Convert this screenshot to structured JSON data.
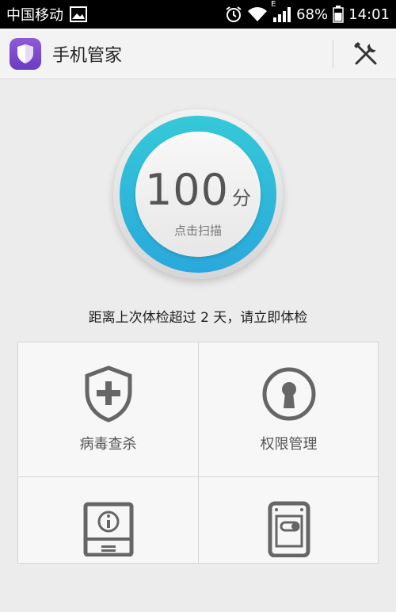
{
  "status_bar": {
    "carrier": "中国移动",
    "network": "E",
    "battery": "68%",
    "time": "14:01"
  },
  "app": {
    "title": "手机管家"
  },
  "score": {
    "value": "100",
    "unit": "分",
    "action": "点击扫描"
  },
  "notice": "距离上次体检超过 2 天，请立即体检",
  "features": [
    {
      "label": "病毒查杀",
      "icon": "shield-plus-icon"
    },
    {
      "label": "权限管理",
      "icon": "keyhole-icon"
    },
    {
      "label": "",
      "icon": "info-device-icon"
    },
    {
      "label": "",
      "icon": "phone-toggle-icon"
    }
  ],
  "colors": {
    "ring_top": "#35c9d8",
    "ring_bottom": "#2aa8dc",
    "logo": "#7b4bd0"
  }
}
